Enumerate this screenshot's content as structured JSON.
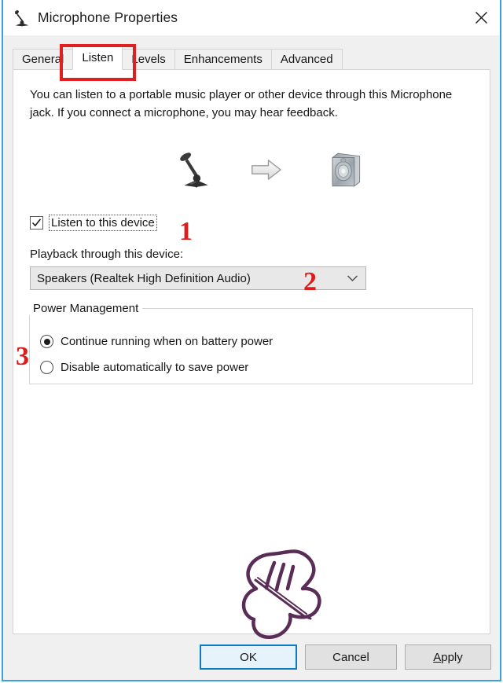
{
  "window": {
    "title": "Microphone Properties",
    "title_icon": "microphone-icon",
    "close_icon": "close-icon",
    "border_color": "#3da0da"
  },
  "tabs": [
    {
      "label": "General",
      "active": false
    },
    {
      "label": "Listen",
      "active": true
    },
    {
      "label": "Levels",
      "active": false
    },
    {
      "label": "Enhancements",
      "active": false
    },
    {
      "label": "Advanced",
      "active": false
    }
  ],
  "panel": {
    "description": "You can listen to a portable music player or other device through this Microphone jack.  If you connect a microphone, you may hear feedback.",
    "illustration": {
      "source_icon": "microphone-icon",
      "arrow_icon": "arrow-right-icon",
      "target_icon": "speaker-icon"
    },
    "listen_checkbox": {
      "label": "Listen to this device",
      "checked": true,
      "focused": true
    },
    "playback": {
      "label": "Playback through this device:",
      "selected": "Speakers (Realtek High Definition Audio)",
      "dropdown_icon": "chevron-down-icon"
    },
    "power_management": {
      "title": "Power Management",
      "options": [
        {
          "label": "Continue running when on battery power",
          "selected": true
        },
        {
          "label": "Disable automatically to save power",
          "selected": false
        }
      ]
    }
  },
  "buttons": {
    "ok": "OK",
    "cancel": "Cancel",
    "apply_prefix": "A",
    "apply_rest": "pply"
  },
  "annotations": {
    "color": "#e01b1b",
    "highlight_target": "Listen",
    "numbers": [
      "1",
      "2",
      "3"
    ],
    "cursor_icon": "pointing-hand-icon",
    "cursor_color": "#5a2d57"
  }
}
